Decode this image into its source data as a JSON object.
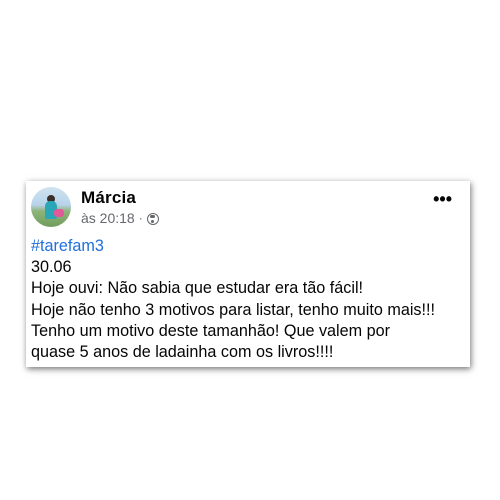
{
  "post": {
    "author": "Márcia",
    "time": "às 20:18",
    "separator": "·",
    "privacy_icon": "globe-icon",
    "more_label": "•••",
    "hashtag": "#tarefam3",
    "lines": [
      "30.06",
      "Hoje ouvi: Não sabia que estudar era tão fácil!",
      "Hoje não tenho 3 motivos para listar, tenho muito mais!!!",
      "Tenho um motivo deste tamanhão! Que valem por",
      "quase 5 anos de ladainha com os livros!!!!"
    ]
  },
  "colors": {
    "hashtag": "#216fdb",
    "meta_text": "#65676b",
    "text": "#050505"
  }
}
